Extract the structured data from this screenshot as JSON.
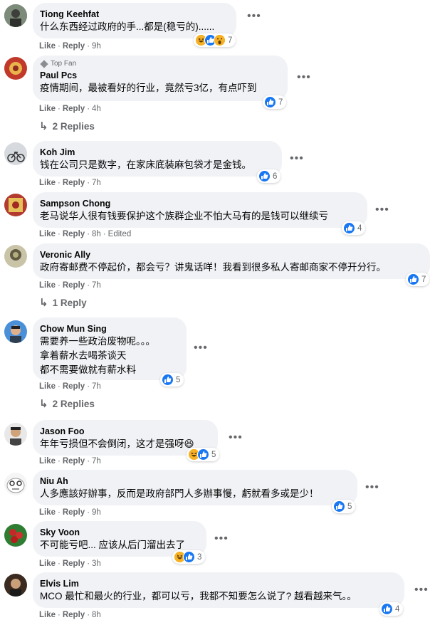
{
  "actions": {
    "like": "Like",
    "reply": "Reply",
    "edited": "Edited"
  },
  "colors": {
    "like_blue": "#1877f2",
    "bubble_gray": "#f0f2f5",
    "meta_gray": "#65676b"
  },
  "comments": [
    {
      "name": "Tiong Keehfat",
      "text": [
        "什么东西经过政府的手...都是(稳亏的)......"
      ],
      "time": "9h",
      "reactions": [
        "haha",
        "like",
        "wow"
      ],
      "count": "7"
    },
    {
      "badge": "Top Fan",
      "name": "Paul Pcs",
      "text": [
        "疫情期间，最被看好的行业，竟然亏3亿，有点吓到"
      ],
      "time": "4h",
      "reactions": [
        "like"
      ],
      "count": "7",
      "replies": "2 Replies"
    },
    {
      "name": "Koh Jim",
      "text": [
        "钱在公司只是数字，在家床底装麻包袋才是金钱。"
      ],
      "time": "7h",
      "reactions": [
        "like"
      ],
      "count": "6"
    },
    {
      "name": "Sampson Chong",
      "text": [
        "老马说华人很有钱要保护这个族群企业不怕大马有的是钱可以继续亏"
      ],
      "time": "8h",
      "reactions": [
        "like"
      ],
      "count": "4"
    },
    {
      "name": "Veronic Ally",
      "text": [
        "政府寄邮费不停起价，都会亏？讲鬼话咩！我看到很多私人寄邮商家不停开分行。"
      ],
      "time": "7h",
      "reactions": [
        "like"
      ],
      "count": "7",
      "replies": "1 Reply"
    },
    {
      "name": "Chow Mun Sing",
      "text": [
        "需要养一些政治废物呢。。。",
        "拿着薪水去喝茶谈天",
        "都不需要做就有薪水料"
      ],
      "time": "7h",
      "reactions": [
        "like"
      ],
      "count": "5",
      "replies": "2 Replies"
    },
    {
      "name": "Jason Foo",
      "text": [
        "年年亏损但不会倒闭，这才是强呀😆"
      ],
      "time": "7h",
      "reactions": [
        "haha",
        "like"
      ],
      "count": "5"
    },
    {
      "name": "Niu Ah",
      "text": [
        "人多應該好辦事，反而是政府部門人多辦事慢，虧就看多或是少！"
      ],
      "time": "9h",
      "reactions": [
        "like"
      ],
      "count": "5"
    },
    {
      "name": "Sky Voon",
      "text": [
        "不可能亏吧... 应该从后门溜出去了"
      ],
      "time": "3h",
      "reactions": [
        "haha",
        "like"
      ],
      "count": "3"
    },
    {
      "name": "Elvis Lim",
      "text": [
        "MCO 最忙和最火的行业，都可以亏，我都不知要怎么说了? 越看越来气。。"
      ],
      "time": "8h",
      "reactions": [
        "like"
      ],
      "count": "4"
    }
  ]
}
